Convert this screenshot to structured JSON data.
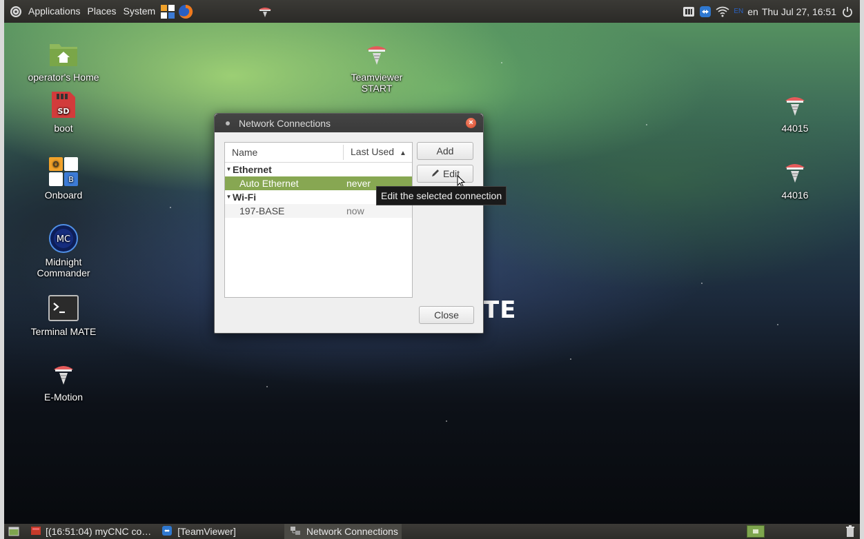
{
  "top_panel": {
    "menus": [
      "Applications",
      "Places",
      "System"
    ],
    "keyboard_layout": "EN",
    "language": "en",
    "clock": "Thu Jul 27, 16:51"
  },
  "desktop": {
    "left_icons": [
      {
        "label": "operator's Home",
        "icon": "home-folder-icon"
      },
      {
        "label": "boot",
        "icon": "sd-card-icon"
      },
      {
        "label": "Onboard",
        "icon": "onboard-keyboard-icon"
      },
      {
        "label": "Midnight Commander",
        "icon": "midnight-commander-icon"
      },
      {
        "label": "Terminal MATE",
        "icon": "terminal-icon"
      },
      {
        "label": "E-Motion",
        "icon": "teamviewer-icon"
      }
    ],
    "center_icons": [
      {
        "label": "Teamviewer START",
        "icon": "teamviewer-icon"
      }
    ],
    "right_icons": [
      {
        "label": "44015",
        "icon": "teamviewer-icon"
      },
      {
        "label": "44016",
        "icon": "teamviewer-icon"
      }
    ],
    "background_text": "TE"
  },
  "dialog": {
    "title": "Network Connections",
    "columns": {
      "name": "Name",
      "last_used": "Last Used"
    },
    "groups": [
      {
        "name": "Ethernet",
        "connections": [
          {
            "name": "Auto Ethernet",
            "last_used": "never",
            "selected": true
          }
        ]
      },
      {
        "name": "Wi-Fi",
        "connections": [
          {
            "name": "197-BASE",
            "last_used": "now",
            "selected": false
          }
        ]
      }
    ],
    "buttons": {
      "add": "Add",
      "edit": "Edit",
      "close": "Close"
    },
    "tooltip": "Edit the selected connection"
  },
  "taskbar": {
    "tasks": [
      {
        "label": "[(16:51:04)  myCNC co…",
        "active": false
      },
      {
        "label": "[TeamViewer]",
        "active": false
      },
      {
        "label": "Network Connections",
        "active": true
      }
    ]
  },
  "colors": {
    "selection": "#87a752",
    "panel": "#2f2e2b",
    "close_button": "#d64a2a"
  }
}
